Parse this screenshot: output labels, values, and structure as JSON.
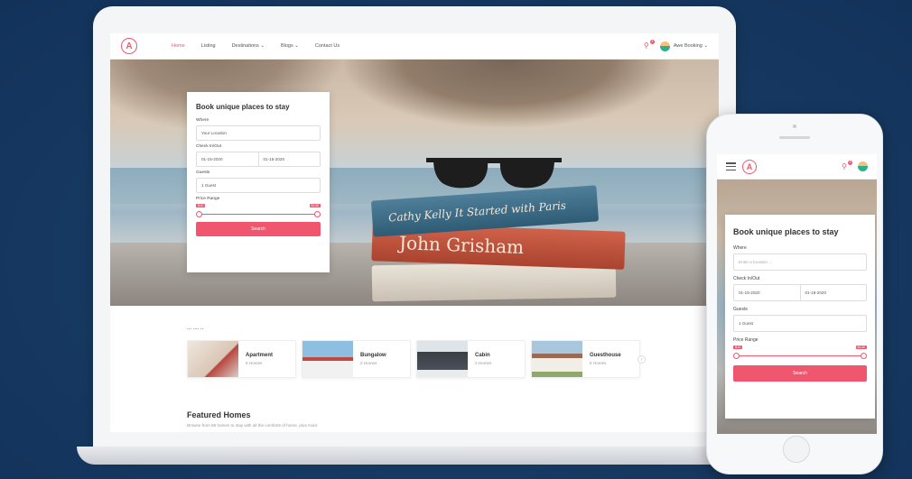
{
  "laptop": {
    "nav": {
      "menu": [
        "Home",
        "Listing",
        "Destinations ⌄",
        "Blogs ⌄",
        "Contact Us"
      ],
      "notif_count": "2",
      "user": "Awe Booking ⌄"
    },
    "booking": {
      "title": "Book unique places to stay",
      "where_label": "Where",
      "where_value": "Your Location",
      "checkin_label": "Check In/Out",
      "checkin": "01-15-2020",
      "checkout": "01-15-2020",
      "guests_label": "Guests",
      "guests_value": "1 Guest",
      "price_label": "Price Range",
      "price_min": "$10",
      "price_max": "$130",
      "search": "Search"
    },
    "book_titles": [
      "Cathy Kelly   It Started with Paris",
      "John Grisham",
      ""
    ],
    "categories_heading": "...    ....  ..",
    "categories": [
      {
        "name": "Apartment",
        "count": "5 Homes"
      },
      {
        "name": "Bungalow",
        "count": "2 Homes"
      },
      {
        "name": "Cabin",
        "count": "2 Homes"
      },
      {
        "name": "Guesthouse",
        "count": "5 Homes"
      }
    ],
    "featured_title": "Featured Homes",
    "featured_sub": "Browse from 88 homes to stay with all the comforts of home, plus more"
  },
  "phone": {
    "notif_count": "2",
    "booking": {
      "title": "Book unique places to stay",
      "where_label": "Where",
      "where_placeholder": "Enter a location ...",
      "checkin_label": "Check In/Out",
      "checkin": "01-15-2020",
      "checkout": "01-18-2020",
      "guests_label": "Guests",
      "guests_value": "1 Guest",
      "price_label": "Price Range",
      "price_min": "$10",
      "price_max": "$130",
      "search": "Search"
    }
  },
  "colors": {
    "accent": "#f0566e",
    "background": "#173a62"
  }
}
